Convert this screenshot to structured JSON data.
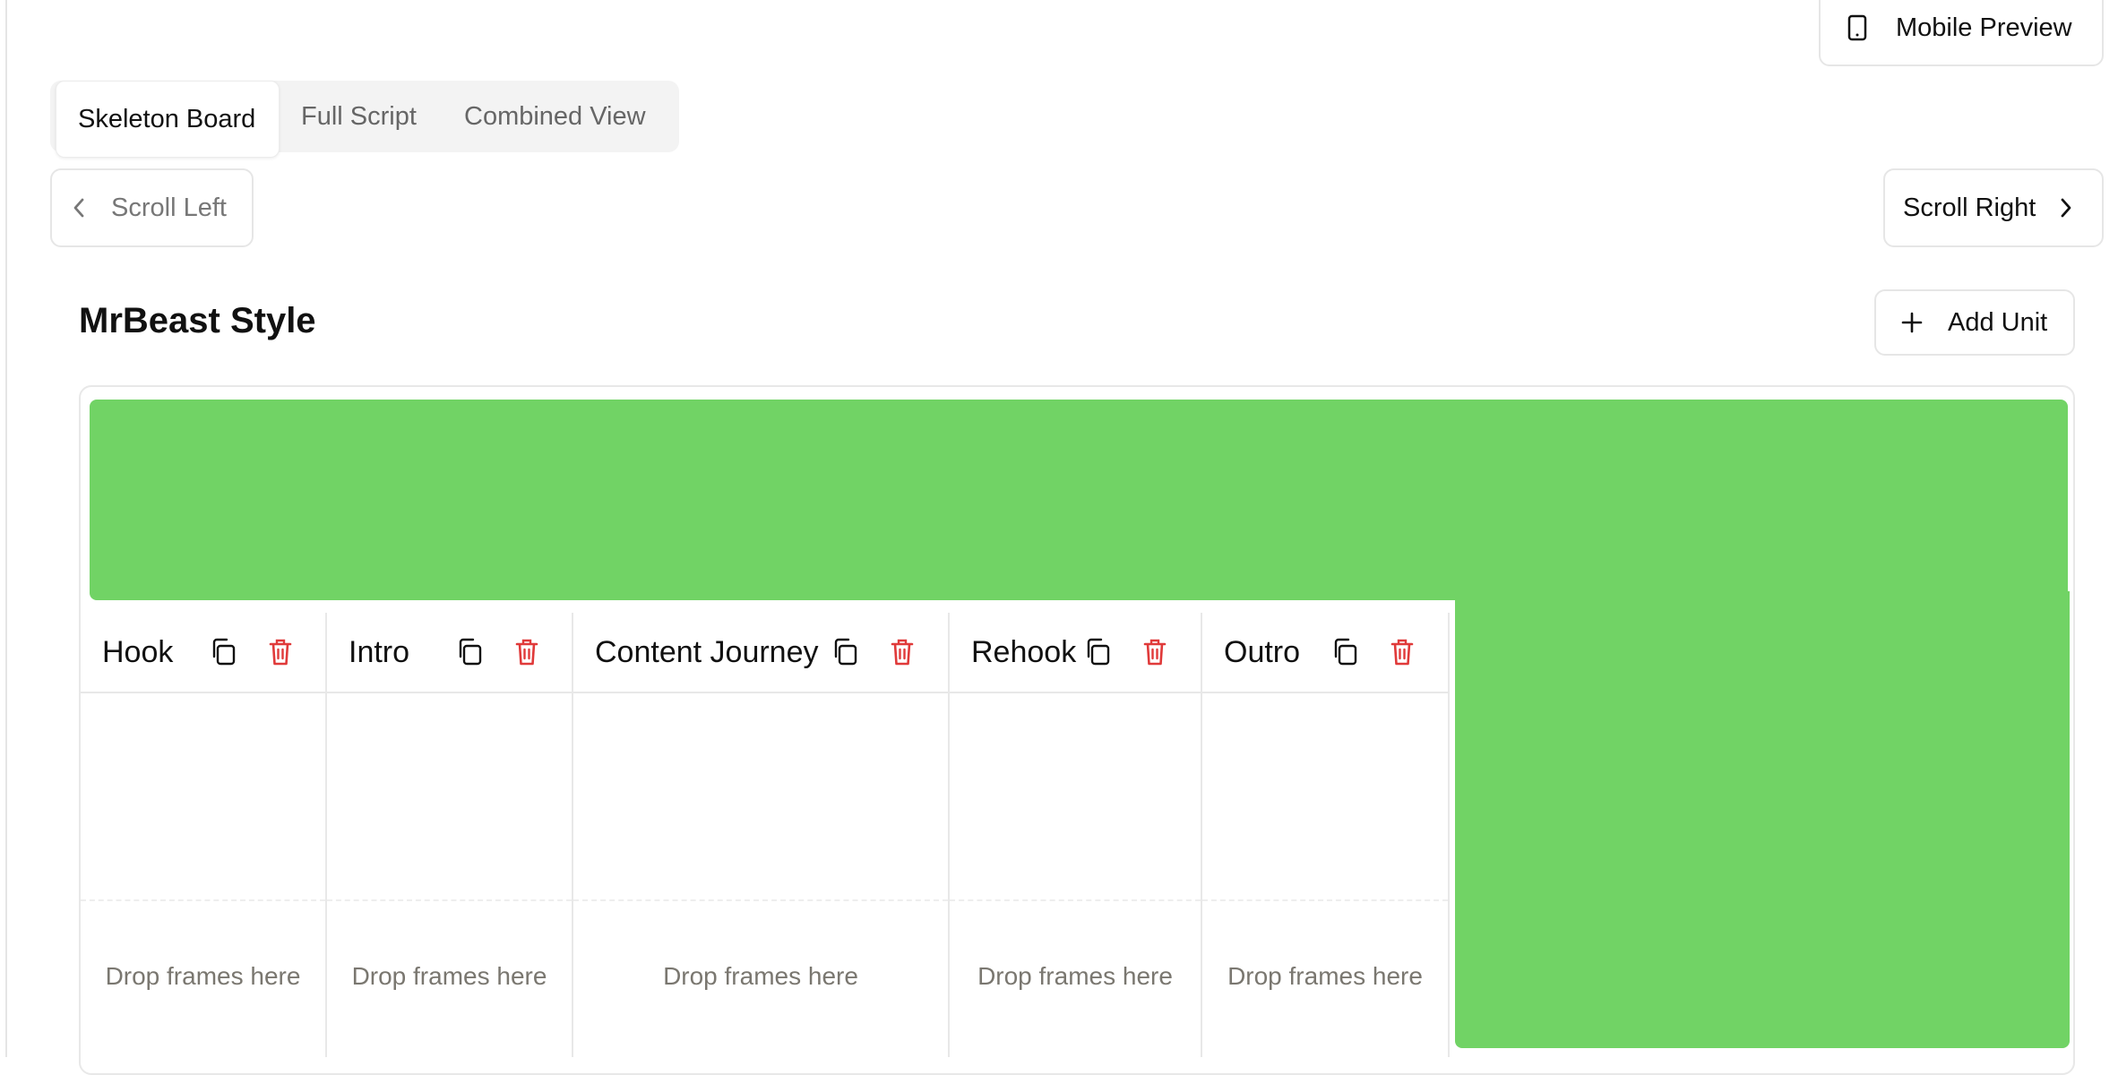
{
  "header": {
    "mobile_preview_label": "Mobile Preview"
  },
  "tabs": [
    {
      "label": "Skeleton Board",
      "active": true
    },
    {
      "label": "Full Script",
      "active": false
    },
    {
      "label": "Combined View",
      "active": false
    }
  ],
  "scroll": {
    "left_label": "Scroll Left",
    "right_label": "Scroll Right"
  },
  "board": {
    "title": "MrBeast Style",
    "add_unit_label": "Add Unit",
    "columns": [
      {
        "title": "Hook",
        "drop_text": "Drop frames here"
      },
      {
        "title": "Intro",
        "drop_text": "Drop frames here"
      },
      {
        "title": "Content Journey",
        "drop_text": "Drop frames here"
      },
      {
        "title": "Rehook",
        "drop_text": "Drop frames here"
      },
      {
        "title": "Outro",
        "drop_text": "Drop frames here"
      }
    ]
  },
  "colors": {
    "banner_green": "#71d365",
    "delete_red": "#e03a3a",
    "border": "#e6e6e6"
  },
  "icons": {
    "mobile": "smartphone-icon",
    "left": "chevron-left-icon",
    "right": "chevron-right-icon",
    "add": "plus-icon",
    "copy": "copy-icon",
    "delete": "trash-icon"
  }
}
